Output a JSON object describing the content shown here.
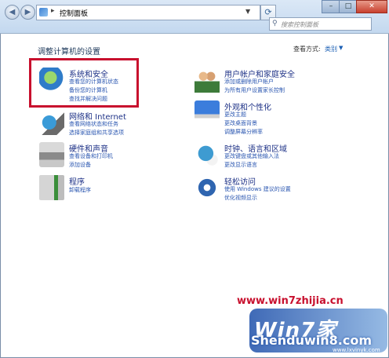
{
  "window": {
    "address_crumb": "控制面板",
    "search_placeholder": "搜索控制面板",
    "minimize_label": "–",
    "maximize_label": "□",
    "close_label": "✕"
  },
  "header": {
    "heading": "调整计算机的设置",
    "view_by_label": "查看方式:",
    "view_by_value": "类别"
  },
  "categories": [
    {
      "title": "系统和安全",
      "links": [
        "查看您的计算机状态",
        "备份您的计算机",
        "查找并解决问题"
      ],
      "icon": "shield-icon"
    },
    {
      "title": "网络和 Internet",
      "links": [
        "查看网络状态和任务",
        "选择家庭组和共享选项"
      ],
      "icon": "network-globe-icon"
    },
    {
      "title": "硬件和声音",
      "links": [
        "查看设备和打印机",
        "添加设备"
      ],
      "icon": "printer-icon"
    },
    {
      "title": "程序",
      "links": [
        "卸载程序"
      ],
      "icon": "programs-icon"
    },
    {
      "title": "用户帐户和家庭安全",
      "links": [
        "添加或删除用户帐户",
        "为所有用户设置家长控制"
      ],
      "icon": "users-icon"
    },
    {
      "title": "外观和个性化",
      "links": [
        "更改主题",
        "更改桌面背景",
        "调整屏幕分辨率"
      ],
      "icon": "monitor-icon"
    },
    {
      "title": "时钟、语言和区域",
      "links": [
        "更改键盘或其他输入法",
        "更改显示语言"
      ],
      "icon": "clock-globe-icon"
    },
    {
      "title": "轻松访问",
      "links": [
        "使用 Windows 建议的设置",
        "优化视频显示"
      ],
      "icon": "ease-of-access-icon"
    }
  ],
  "watermark": {
    "url": "www.win7zhijia.cn",
    "logo_text": "Win7家",
    "site": "Shenduwin8.com",
    "site2": "www.lxvinyk.com"
  }
}
